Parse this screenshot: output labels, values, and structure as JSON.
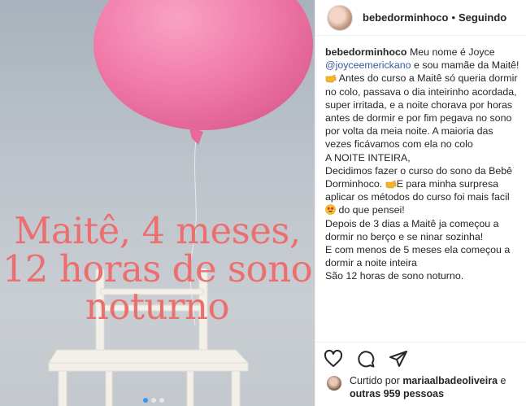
{
  "post": {
    "image": {
      "overlay_line1": "Maitê, 4 meses,",
      "overlay_line2": "12 horas de sono",
      "overlay_line3": "noturno",
      "overlay_color": "#ec6f6f",
      "carousel_dots": 3,
      "active_dot": 1
    },
    "header": {
      "username": "bebedorminhoco",
      "separator": "•",
      "follow_status": "Seguindo"
    },
    "caption": {
      "username": "bebedorminhoco",
      "part1": " Meu nome é Joyce ",
      "mention": "@joyceemerickano",
      "part2": " e sou mamãe da Maitê! ",
      "part3": "Antes do curso a Maitê só queria dormir no colo, passava o dia inteirinho acordada, super irritada, e a noite chorava por horas antes de dormir e por fim pegava no sono por volta da meia noite.  A maioria das vezes ficávamos com ela no colo",
      "line_a": "A  NOITE INTEIRA,",
      "line_b1": "Decidimos fazer o curso do sono da Bebê Dorminhoco. ",
      "line_b2": "E para minha surpresa aplicar os métodos do curso foi mais facil ",
      "line_b3": " do que pensei!",
      "line_c": "Depois de 3 dias a Maitê ja começou a dormir no berço e se ninar sozinha!",
      "line_d": "E com menos de 5 meses ela começou a dormir a noite inteira",
      "line_e": "São 12 horas de sono noturno."
    },
    "likes": {
      "prefix": "Curtido por ",
      "liker": "mariaalbadeoliveira",
      "middle": " e",
      "others": "outras 959 pessoas"
    },
    "icons": {
      "like": "heart-icon",
      "comment": "comment-icon",
      "share": "share-icon",
      "hand": "pointing-hand-emoji",
      "face": "star-struck-emoji"
    }
  }
}
